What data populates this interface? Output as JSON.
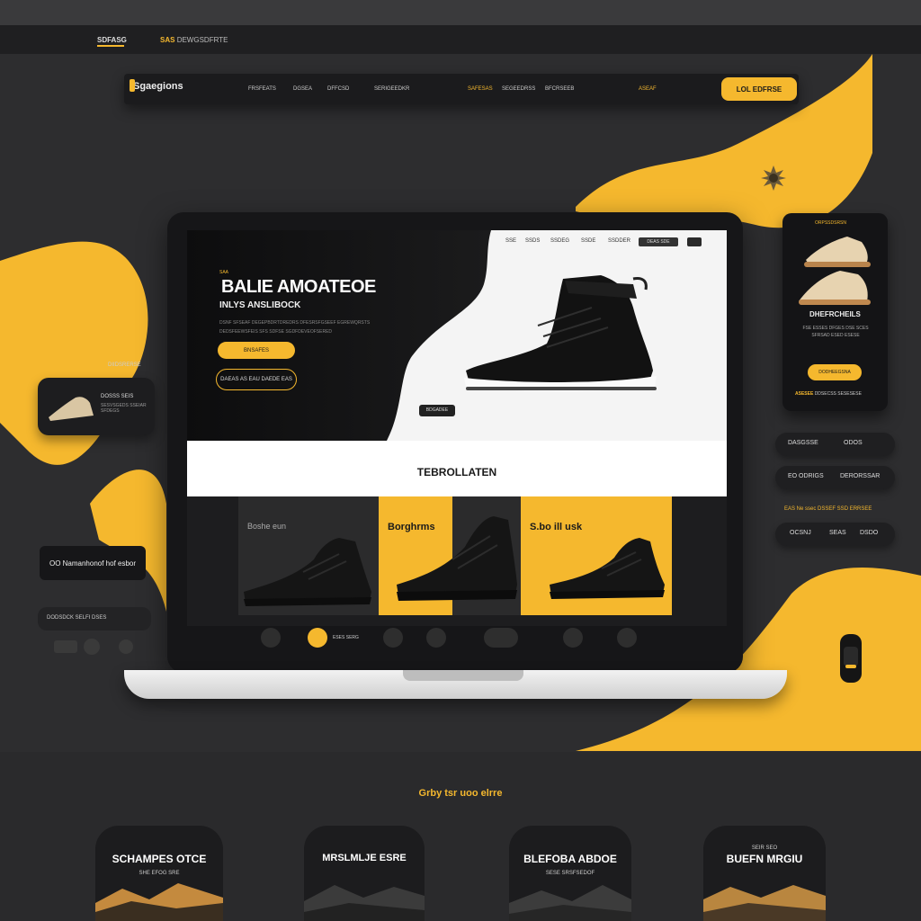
{
  "colors": {
    "accent": "#f5b82e",
    "background": "#2d2d2f",
    "panel": "#1b1b1d"
  },
  "topbar": {
    "left_label": "SDFASG",
    "right_label": "SAS",
    "right_label2": "DEWGSDFRTE"
  },
  "navbar": {
    "logo": "Sgaegions",
    "items": [
      "FRSFEATS",
      "DGSEA",
      "DFFCSD",
      "SERIGEEDKR",
      "SAFESAS",
      "SEGEEDRSS",
      "BFCRSEEB",
      "ASEAF"
    ],
    "cta": "LOL EDFRSE"
  },
  "hero": {
    "mini_nav": [
      "SSE",
      "SSDS",
      "SSDEG",
      "SSDE",
      "SSDDER"
    ],
    "mini_btn": "DEAS SDE",
    "eyebrow": "SAA",
    "title": "BALIE AMOATEOE",
    "subtitle": "INLYS ANSLIBOCK",
    "body": "DSNF SFSEAF DEGEPBDRTDREDRS DFESRSFGSEEF EGREWQRSTS DEDSFEEWSFEIS SFS SDFSE SGDFDEVEOFSERED",
    "primary_btn": "BNSAFES",
    "secondary_btn": "DAEAS AS EAU DAEDE EAS",
    "pill": "BDGADEE"
  },
  "section_title": "TEBROLLATEN",
  "product_cards": [
    {
      "title": "Boshe eun"
    },
    {
      "title": "Borghrms"
    },
    {
      "title": "S.bo ill usk"
    }
  ],
  "icon_row": {
    "label": "ESES SERG"
  },
  "left_widgets": {
    "label": "DIIDSRERSE",
    "card_title": "DOSSS SEIS",
    "card_sub": "SESVSGEDS SSEIAR SFDEGS",
    "dark_pill": "OO Namanhonof hof esbor",
    "small_pill": "DODSDCK SELFI DSES"
  },
  "phone": {
    "label": "ORPSSDSRSN",
    "title": "DHEFRCHEILS",
    "subtitle": "FSE ESSES DFGES DSE SCES SFRSAD ESED ESESE",
    "button": "DODHEEGSNA",
    "footer_a": "ASESEE",
    "footer_b": "DDSECSS SESESESE"
  },
  "right_pills": [
    {
      "a": "DASGSSE",
      "b": "ODOS"
    },
    {
      "a": "EO ODRIGS",
      "b": "DERORSSAR"
    },
    {
      "a": "OCSNJ",
      "b": "SEAS",
      "c": "DSDO"
    }
  ],
  "right_text": "EAS Ne ssec DSSEF SSD ERRSEE",
  "bottom": {
    "title": "Grby tsr uoo elrre",
    "cards": [
      {
        "title": "SCHAMPES OTCE",
        "sub": "SHE EFOG SRE"
      },
      {
        "title": "MRSLMLJE ESRE",
        "sub": ""
      },
      {
        "title": "BLEFOBA ABDOE",
        "sub": "SESE SRSFSEDOF"
      },
      {
        "title": "BUEFN MRGIU",
        "sub": "SEIR SEO"
      }
    ]
  }
}
